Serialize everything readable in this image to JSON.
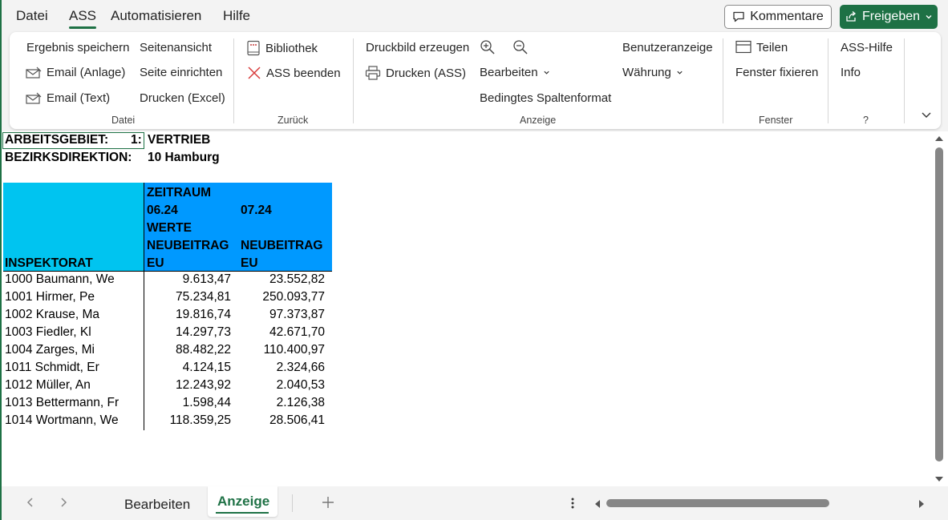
{
  "menu": {
    "tabs": [
      "Datei",
      "ASS",
      "Automatisieren",
      "Hilfe"
    ],
    "active": "ASS",
    "comment_label": "Kommentare",
    "share_label": "Freigeben"
  },
  "ribbon": {
    "datei": {
      "label": "Datei",
      "save_result": "Ergebnis speichern",
      "page_view": "Seitenansicht",
      "email_attach": "Email (Anlage)",
      "page_setup": "Seite einrichten",
      "email_text": "Email (Text)",
      "print_excel": "Drucken (Excel)"
    },
    "zurueck": {
      "label": "Zurück",
      "library": "Bibliothek",
      "ass_exit": "ASS beenden"
    },
    "anzeige": {
      "label": "Anzeige",
      "print_image": "Druckbild erzeugen",
      "print_ass": "Drucken (ASS)",
      "edit": "Bearbeiten",
      "cond_format": "Bedingtes Spaltenformat",
      "user_display": "Benutzeranzeige",
      "currency": "Währung"
    },
    "fenster": {
      "label": "Fenster",
      "split": "Teilen",
      "freeze": "Fenster fixieren"
    },
    "help": {
      "label": "?",
      "ass_help": "ASS-Hilfe",
      "info": "Info"
    }
  },
  "sheet": {
    "line1_label": "ARBEITSGEBIET:",
    "line1_code": "1:",
    "line1_value": "VERTRIEB",
    "line2_label": "BEZIRKSDIREKTION:",
    "line2_value": "10 Hamburg",
    "header": {
      "zeitraum": "ZEITRAUM",
      "period1": "06.24",
      "period2": "07.24",
      "werte": "WERTE",
      "col_a_line1": "NEUBEITRAG",
      "col_a_line2": "EU",
      "col_b_line1": "NEUBEITRAG",
      "col_b_line2": "EU",
      "row_header": "INSPEKTORAT"
    },
    "rows": [
      {
        "name": "1000 Baumann, We",
        "v1": "9.613,47",
        "v2": "23.552,82"
      },
      {
        "name": "1001 Hirmer, Pe",
        "v1": "75.234,81",
        "v2": "250.093,77"
      },
      {
        "name": "1002 Krause, Ma",
        "v1": "19.816,74",
        "v2": "97.373,87"
      },
      {
        "name": "1003 Fiedler, Kl",
        "v1": "14.297,73",
        "v2": "42.671,70"
      },
      {
        "name": "1004 Zarges, Mi",
        "v1": "88.482,22",
        "v2": "110.400,97"
      },
      {
        "name": "1011 Schmidt, Er",
        "v1": "4.124,15",
        "v2": "2.324,66"
      },
      {
        "name": "1012 Müller, An",
        "v1": "12.243,92",
        "v2": "2.040,53"
      },
      {
        "name": "1013 Bettermann, Fr",
        "v1": "1.598,44",
        "v2": "2.126,38"
      },
      {
        "name": "1014 Wortmann, We",
        "v1": "118.359,25",
        "v2": "28.506,41"
      }
    ]
  },
  "bottom": {
    "tab1": "Bearbeiten",
    "tab2": "Anzeige",
    "active": "Anzeige"
  },
  "colors": {
    "accent": "#1e7145",
    "header_cyan": "#00c4f0",
    "header_blue": "#0099ff"
  }
}
